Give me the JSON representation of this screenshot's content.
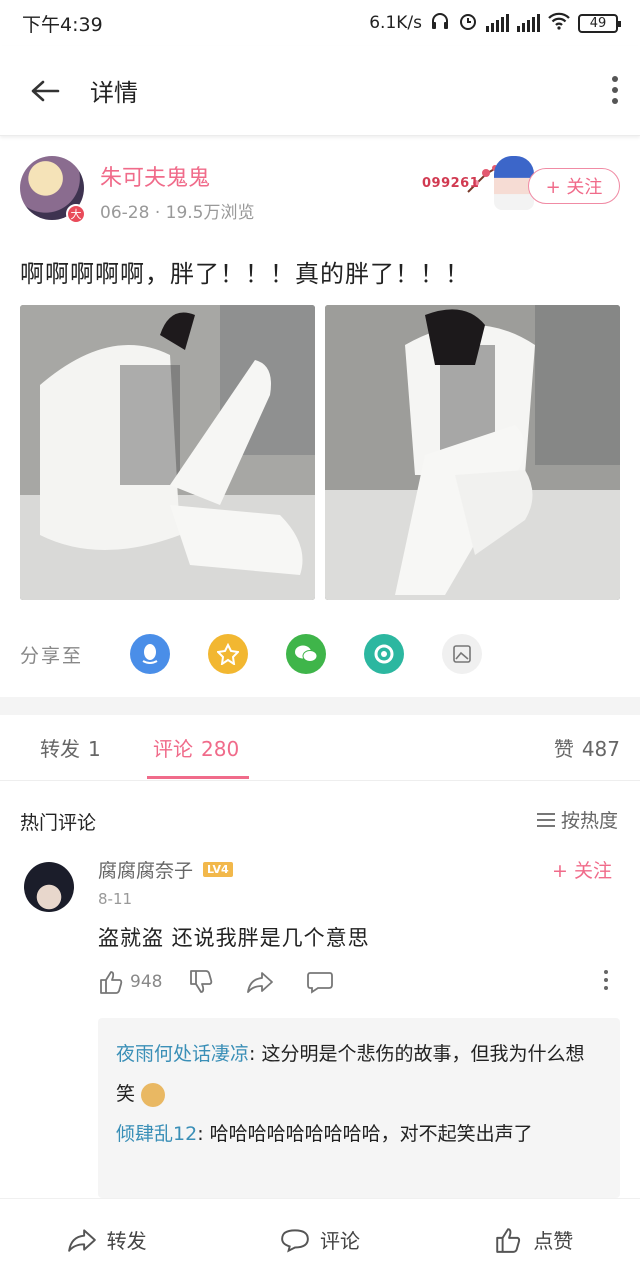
{
  "status_bar": {
    "time": "下午4:39",
    "net_speed": "6.1K/s",
    "battery": "49"
  },
  "app_bar": {
    "title": "详情"
  },
  "post": {
    "author_name": "朱可夫鬼鬼",
    "date": "06-28",
    "views": "19.5万浏览",
    "medal_number": "099261",
    "follow_label": "+ 关注",
    "text": "啊啊啊啊啊，胖了！！！真的胖了！！！"
  },
  "share": {
    "label": "分享至",
    "targets": [
      "qq-icon",
      "qzone-icon",
      "wechat-icon",
      "moments-icon",
      "save-image-icon"
    ],
    "colors": {
      "qq": "#4a8ee8",
      "qzone": "#f2b731",
      "wechat": "#3fb54a",
      "moments": "#2cb7a0"
    }
  },
  "tabs": {
    "repost_label": "转发",
    "repost_count": "1",
    "comment_label": "评论",
    "comment_count": "280",
    "like_label": "赞",
    "like_count": "487",
    "accent": "#f06b8a"
  },
  "comments": {
    "section_title": "热门评论",
    "sort_label": "按热度",
    "items": [
      {
        "user": "腐腐腐奈子",
        "level": "LV4",
        "follow_label": "+ 关注",
        "date": "8-11",
        "text": "盗就盗 还说我胖是几个意思",
        "likes": "948",
        "replies": [
          {
            "user": "夜雨何处话凄凉",
            "text": "这分明是个悲伤的故事，但我为什么想笑"
          },
          {
            "user": "倾肆乱12",
            "text": "哈哈哈哈哈哈哈哈哈，对不起笑出声了"
          }
        ]
      }
    ]
  },
  "bottom_bar": {
    "repost": "转发",
    "comment": "评论",
    "like": "点赞"
  }
}
